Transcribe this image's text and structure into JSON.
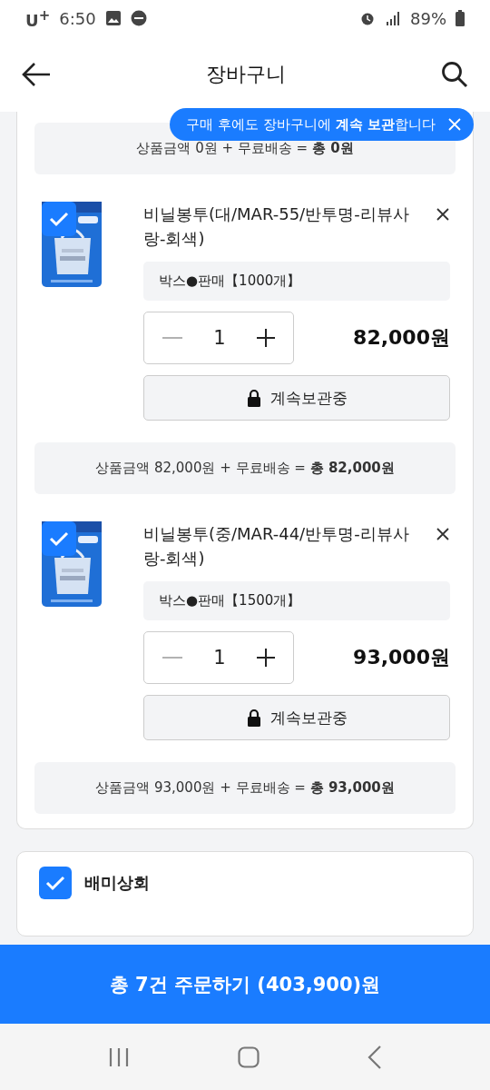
{
  "status_bar": {
    "carrier": "U$^{+}$",
    "time": "6:50",
    "battery": "89%"
  },
  "header": {
    "title": "장바구니"
  },
  "tooltip": {
    "text": "구매 후에도 장바구니에 **계속 보관**합니다"
  },
  "cart_card": {
    "top_summary": "상품금액 0원 + 무료배송 = **총 0원**",
    "items": [
      {
        "selected": true,
        "name": "비닐봉투(대/MAR-55/반투명-리뷰사랑-회색)",
        "option": "박스●판매【1000개】",
        "quantity": "1",
        "price": "82,000원",
        "keep_button": "계속보관중",
        "summary": "상품금액 82,000원 + 무료배송 = **총 82,000원**"
      },
      {
        "selected": true,
        "name": "비닐봉투(중/MAR-44/반투명-리뷰사랑-회색)",
        "option": "박스●판매【1500개】",
        "quantity": "1",
        "price": "93,000원",
        "keep_button": "계속보관중",
        "summary": "상품금액 93,000원 + 무료배송 = **총 93,000원**"
      }
    ]
  },
  "next_store": {
    "name": "배미상회",
    "selected": true
  },
  "order_button": "총 7건 주문하기 (403,900)원"
}
